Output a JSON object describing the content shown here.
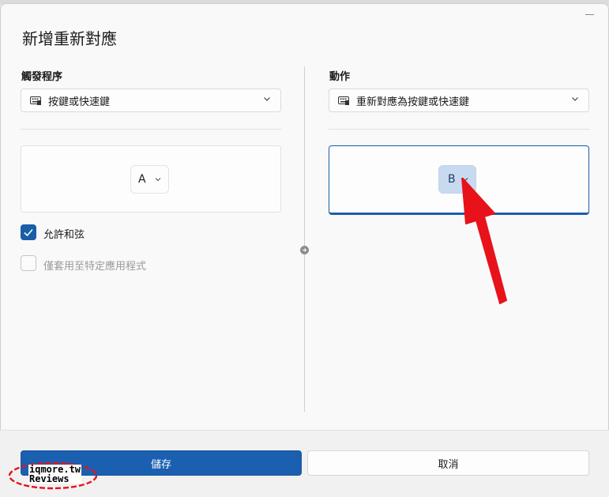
{
  "dialog": {
    "title": "新增重新對應"
  },
  "trigger": {
    "label": "觸發程序",
    "select_value": "按鍵或快速鍵",
    "select_icon": "keyboard-icon",
    "key": "A",
    "allow_chords_label": "允許和弦",
    "allow_chords_checked": true,
    "specific_app_label": "僅套用至特定應用程式",
    "specific_app_checked": false
  },
  "action": {
    "label": "動作",
    "select_value": "重新對應為按鍵或快速鍵",
    "select_icon": "keyboard-icon",
    "key": "B"
  },
  "footer": {
    "save_label": "儲存",
    "cancel_label": "取消"
  },
  "watermark": {
    "line1": "iqmore.tw",
    "line2": "Reviews"
  },
  "colors": {
    "accent": "#1a5fb0",
    "annotation_arrow": "#e8121a"
  }
}
